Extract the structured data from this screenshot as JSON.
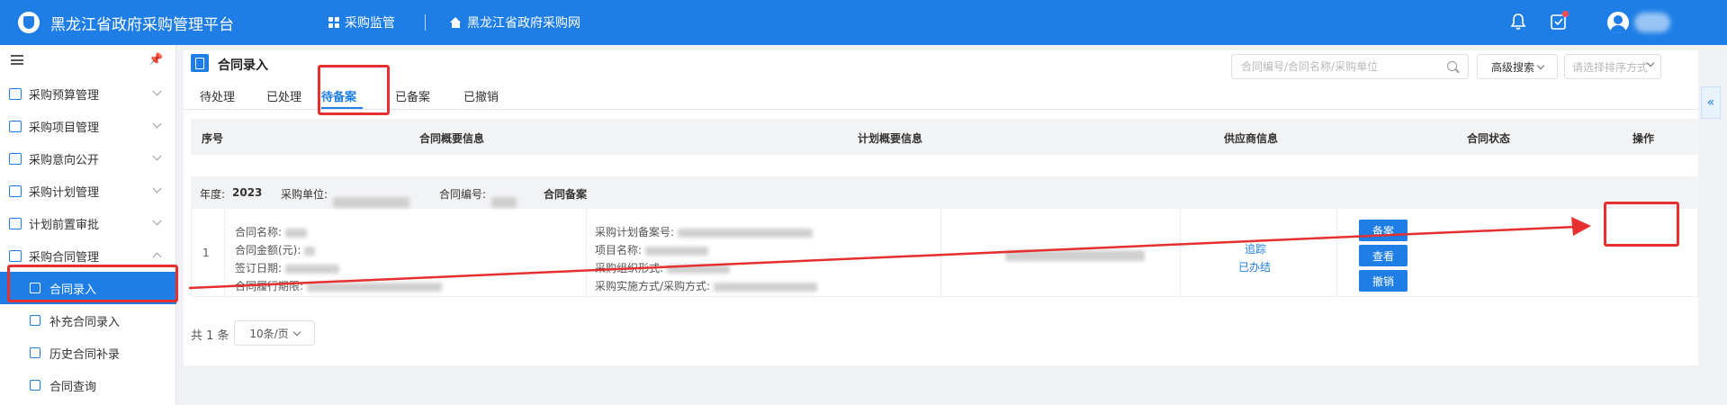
{
  "header": {
    "app_title": "黑龙江省政府采购管理平台",
    "nav_monitor": "采购监管",
    "nav_site": "黑龙江省政府采购网"
  },
  "sidebar": {
    "items": [
      {
        "label": "采购预算管理"
      },
      {
        "label": "采购项目管理"
      },
      {
        "label": "采购意向公开"
      },
      {
        "label": "采购计划管理"
      },
      {
        "label": "计划前置审批"
      },
      {
        "label": "采购合同管理"
      }
    ],
    "sub_items": [
      {
        "label": "合同录入"
      },
      {
        "label": "补充合同录入"
      },
      {
        "label": "历史合同补录"
      },
      {
        "label": "合同查询"
      }
    ]
  },
  "page": {
    "title": "合同录入",
    "search_placeholder": "合同编号/合同名称/采购单位",
    "advanced_search": "高级搜索",
    "sort_placeholder": "请选择排序方式"
  },
  "tabs": [
    "待处理",
    "已处理",
    "待备案",
    "已备案",
    "已撤销"
  ],
  "table": {
    "headers": [
      "序号",
      "合同概要信息",
      "计划概要信息",
      "供应商信息",
      "合同状态",
      "操作"
    ],
    "group": {
      "year_label": "年度:",
      "year": "2023",
      "unit_label": "采购单位:",
      "contract_no_label": "合同编号:",
      "status_text": "合同备案"
    },
    "row": {
      "index": "1",
      "contract_name_label": "合同名称:",
      "contract_amount_label": "合同金额(元):",
      "sign_date_label": "签订日期:",
      "period_label": "合同履行期限:",
      "plan_no_label": "采购计划备案号:",
      "project_name_label": "项目名称:",
      "org_form_label": "采购组织形式:",
      "method_label": "采购实施方式/采购方式:",
      "status_link": "追踪",
      "status_text": "已办结",
      "actions": {
        "file": "备案",
        "view": "查看",
        "revoke": "撤销"
      }
    }
  },
  "pagination": {
    "total": "共 1 条",
    "page_size": "10条/页"
  },
  "annotation": {
    "color": "#e62f2f"
  }
}
